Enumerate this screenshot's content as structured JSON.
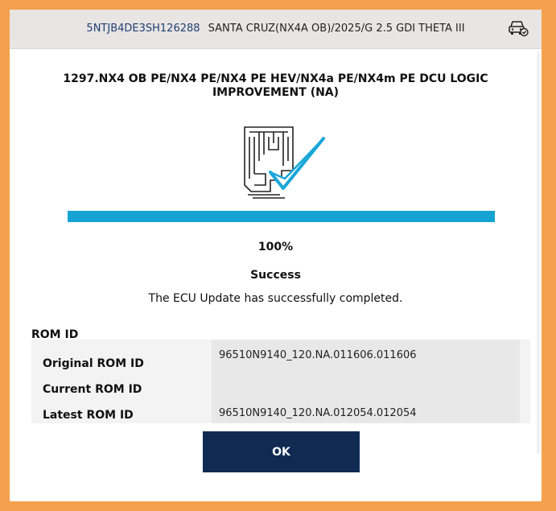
{
  "header": {
    "vin": "5NTJB4DE3SH126288",
    "vehicle": "SANTA CRUZ(NX4A OB)/2025/G 2.5 GDI THETA III",
    "icon": "car-connected-icon"
  },
  "dialog": {
    "title": "1297.NX4 OB PE/NX4 PE/NX4 PE HEV/NX4a PE/NX4m PE DCU LOGIC IMPROVEMENT (NA)",
    "graphic_icon": "ecu-update-success-icon"
  },
  "progress": {
    "percent": 100,
    "label": "100%"
  },
  "status": {
    "title": "Success",
    "message": "The ECU Update has successfully completed."
  },
  "rom": {
    "heading": "ROM ID",
    "rows": [
      {
        "label": "Original ROM ID",
        "value": "96510N9140_120.NA.011606.011606"
      },
      {
        "label": "Current ROM ID",
        "value": ""
      },
      {
        "label": "Latest ROM ID",
        "value": "96510N9140_120.NA.012054.012054"
      }
    ]
  },
  "actions": {
    "ok_label": "OK"
  },
  "colors": {
    "frame_border": "#f4a14d",
    "progress": "#14a3d3",
    "button": "#102a52",
    "check_accent": "#19a7d8"
  }
}
